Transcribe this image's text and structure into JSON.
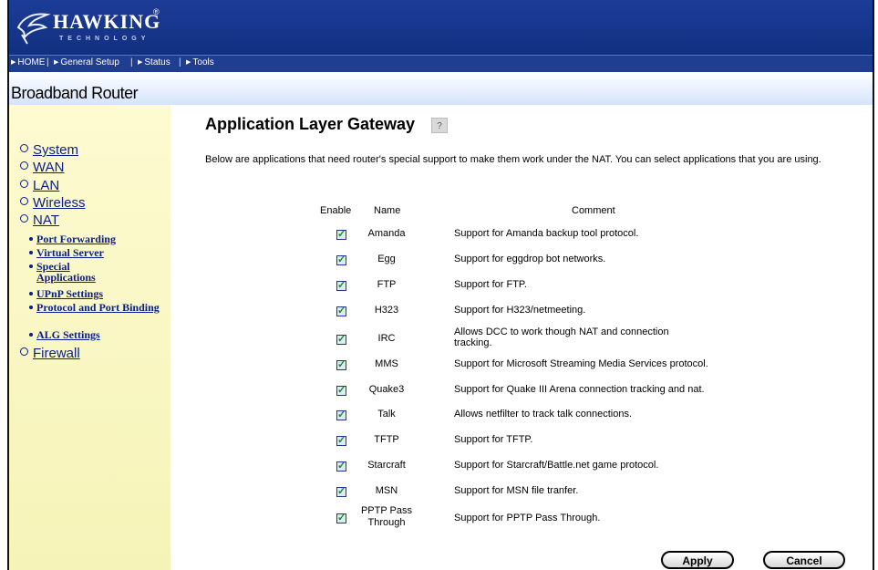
{
  "header": {
    "logo_text": "HAWKING",
    "logo_registered": "®",
    "logo_sub": "TECHNOLOGY",
    "brand_color": "#1c3c99"
  },
  "nav": {
    "items": [
      {
        "label": "HOME",
        "icon": "triangle-right-icon"
      },
      {
        "label": "General Setup",
        "icon": "triangle-right-icon"
      },
      {
        "label": "Status",
        "icon": "triangle-right-icon"
      },
      {
        "label": "Tools",
        "icon": "triangle-right-icon"
      }
    ],
    "separator": "|"
  },
  "brand": "Broadband Router",
  "sidebar": {
    "main_items": [
      {
        "label": "System"
      },
      {
        "label": "WAN"
      },
      {
        "label": "LAN"
      },
      {
        "label": "Wireless"
      },
      {
        "label": "NAT"
      },
      {
        "label": "Firewall"
      }
    ],
    "nat_sub_items": [
      {
        "label": "Port Forwarding"
      },
      {
        "label": "Virtual Server"
      },
      {
        "label": "Special Applications"
      },
      {
        "label": "UPnP Settings"
      },
      {
        "label": "Protocol and Port Binding"
      },
      {
        "label": "ALG Settings"
      }
    ]
  },
  "content": {
    "title": "Application Layer Gateway",
    "help_icon": "?",
    "description": "Below are applications that need router's special support to make them work under the NAT. You can select applications that you are using.",
    "columns": {
      "enable": "Enable",
      "name": "Name",
      "comment": "Comment"
    },
    "rows": [
      {
        "name": "Amanda",
        "comment": "Support for Amanda backup tool protocol.",
        "enabled": true
      },
      {
        "name": "Egg",
        "comment": "Support for eggdrop bot networks.",
        "enabled": true
      },
      {
        "name": "FTP",
        "comment": "Support for FTP.",
        "enabled": true
      },
      {
        "name": "H323",
        "comment": "Support for H323/netmeeting.",
        "enabled": true
      },
      {
        "name": "IRC",
        "comment": "Allows DCC to work though NAT and connection tracking.",
        "enabled": true
      },
      {
        "name": "MMS",
        "comment": "Support for Microsoft Streaming Media Services protocol.",
        "enabled": true
      },
      {
        "name": "Quake3",
        "comment": "Support for Quake III Arena connection tracking and nat.",
        "enabled": true
      },
      {
        "name": "Talk",
        "comment": "Allows netfilter to track talk connections.",
        "enabled": true
      },
      {
        "name": "TFTP",
        "comment": "Support for TFTP.",
        "enabled": true
      },
      {
        "name": "Starcraft",
        "comment": "Support for Starcraft/Battle.net game protocol.",
        "enabled": true
      },
      {
        "name": "MSN",
        "comment": "Support for MSN file tranfer.",
        "enabled": true
      },
      {
        "name": "PPTP Pass Through",
        "comment": "Support for PPTP Pass Through.",
        "enabled": true
      }
    ],
    "apply_label": "Apply",
    "cancel_label": "Cancel"
  }
}
